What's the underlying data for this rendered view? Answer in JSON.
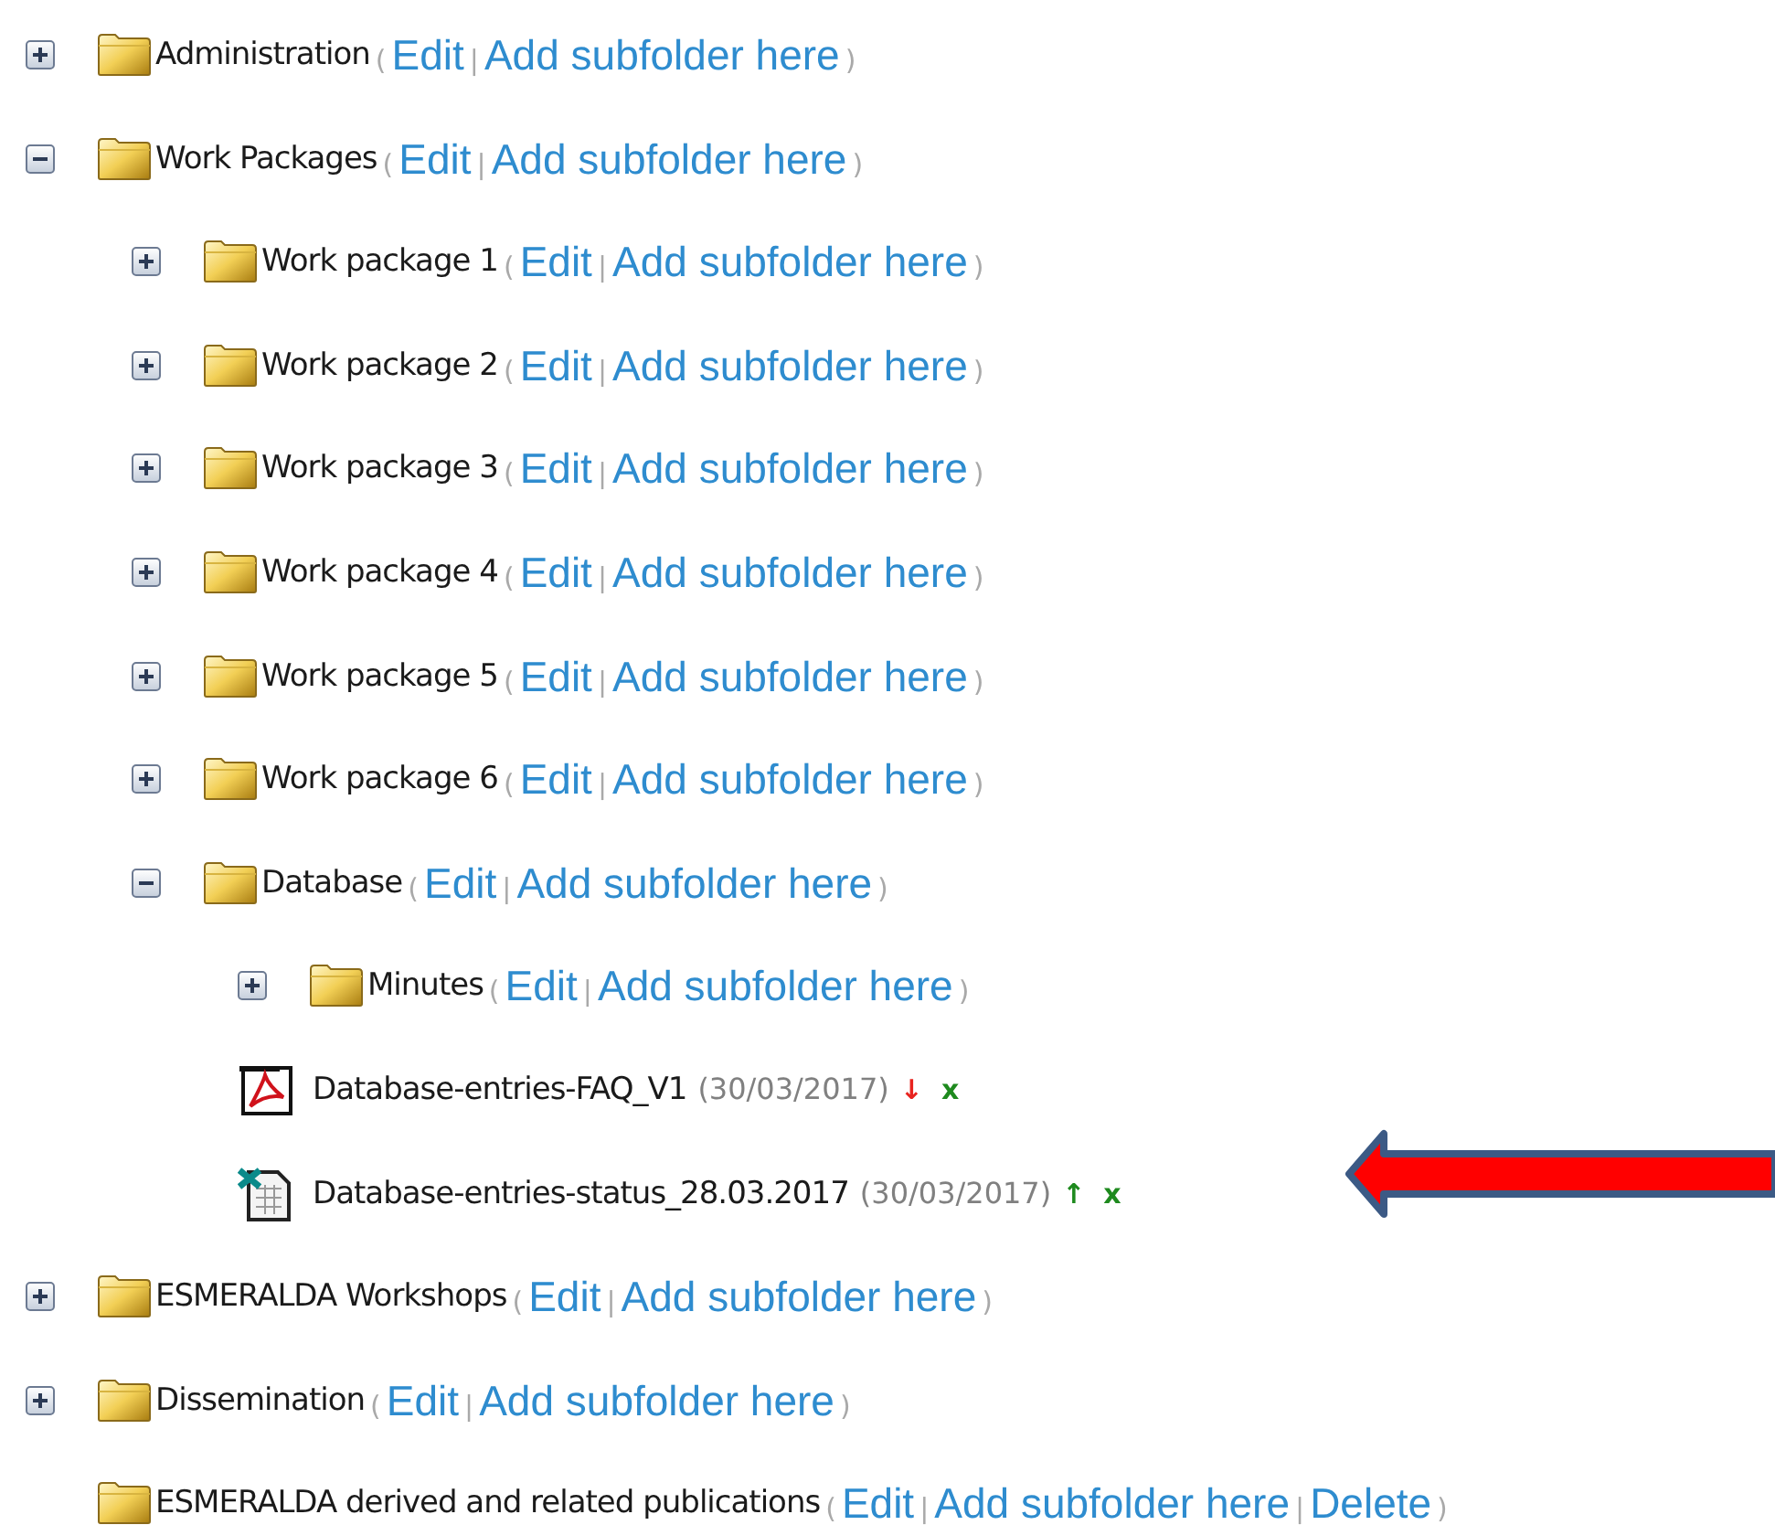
{
  "punctuation": {
    "open": "(",
    "separator": "|",
    "close": ")"
  },
  "tree": [
    {
      "kind": "folder",
      "label": "Administration",
      "expanded": false,
      "actions": [
        "Edit",
        "Add subfolder here"
      ]
    },
    {
      "kind": "folder",
      "label": "Work Packages",
      "expanded": true,
      "actions": [
        "Edit",
        "Add subfolder here"
      ],
      "children": [
        {
          "kind": "folder",
          "label": "Work package 1",
          "expanded": false,
          "actions": [
            "Edit",
            "Add subfolder here"
          ]
        },
        {
          "kind": "folder",
          "label": "Work package 2",
          "expanded": false,
          "actions": [
            "Edit",
            "Add subfolder here"
          ]
        },
        {
          "kind": "folder",
          "label": "Work package 3",
          "expanded": false,
          "actions": [
            "Edit",
            "Add subfolder here"
          ]
        },
        {
          "kind": "folder",
          "label": "Work package 4",
          "expanded": false,
          "actions": [
            "Edit",
            "Add subfolder here"
          ]
        },
        {
          "kind": "folder",
          "label": "Work package 5",
          "expanded": false,
          "actions": [
            "Edit",
            "Add subfolder here"
          ]
        },
        {
          "kind": "folder",
          "label": "Work package 6",
          "expanded": false,
          "actions": [
            "Edit",
            "Add subfolder here"
          ]
        },
        {
          "kind": "folder",
          "label": "Database",
          "expanded": true,
          "actions": [
            "Edit",
            "Add subfolder here"
          ],
          "children": [
            {
              "kind": "folder",
              "label": "Minutes",
              "expanded": false,
              "actions": [
                "Edit",
                "Add subfolder here"
              ]
            },
            {
              "kind": "pdf_file",
              "label": "Database-entries-FAQ_V1",
              "date": "(30/03/2017)",
              "move": "↓",
              "color": "#e8231f",
              "remove": "x"
            },
            {
              "kind": "sheet_file",
              "label": "Database-entries-status_28.03.2017",
              "date": "(30/03/2017)",
              "move": "↑",
              "color": "#1e8a1e",
              "remove": "x"
            }
          ]
        }
      ]
    },
    {
      "kind": "folder",
      "label": "ESMERALDA Workshops",
      "expanded": false,
      "actions": [
        "Edit",
        "Add subfolder here"
      ]
    },
    {
      "kind": "folder",
      "label": "Dissemination",
      "expanded": false,
      "actions": [
        "Edit",
        "Add subfolder here"
      ]
    },
    {
      "kind": "folder",
      "label": "ESMERALDA derived and related publications",
      "actions": [
        "Edit",
        "Add subfolder here",
        "Delete"
      ]
    }
  ]
}
